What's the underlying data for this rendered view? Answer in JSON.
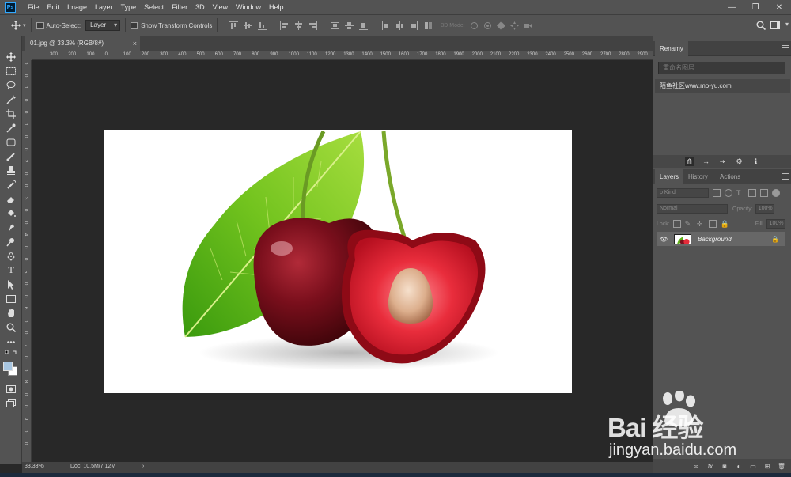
{
  "menubar": {
    "logo": "Ps",
    "items": [
      "File",
      "Edit",
      "Image",
      "Layer",
      "Type",
      "Select",
      "Filter",
      "3D",
      "View",
      "Window",
      "Help"
    ]
  },
  "options": {
    "auto_select_label": "Auto-Select:",
    "auto_select_value": "Layer",
    "transform_label": "Show Transform Controls",
    "mode3d_label": "3D Mode:"
  },
  "document": {
    "tab_title": "01.jpg @ 33.3% (RGB/8#)",
    "close_glyph": "×"
  },
  "ruler": {
    "top_labels": [
      "300",
      "200",
      "100",
      "0",
      "100",
      "200",
      "300",
      "400",
      "500",
      "600",
      "700",
      "800",
      "900",
      "1000",
      "1100",
      "1200",
      "1300",
      "1400",
      "1500",
      "1600",
      "1700",
      "1800",
      "1900",
      "2000",
      "2100",
      "2200",
      "2300",
      "2400",
      "2500",
      "2600",
      "2700",
      "2800",
      "2900"
    ],
    "left_labels": [
      "0",
      "0",
      "1",
      "0",
      "0",
      "1",
      "0",
      "0",
      "2",
      "0",
      "0",
      "3",
      "0",
      "0",
      "4",
      "0",
      "0",
      "5",
      "0",
      "0",
      "6",
      "0",
      "0",
      "7",
      "0",
      "0",
      "8",
      "0",
      "0",
      "9",
      "0",
      "0"
    ]
  },
  "status": {
    "zoom": "33.33%",
    "doc_info": "Doc: 10.5M/7.12M",
    "arrow": "›"
  },
  "rename_panel": {
    "tab_label": "Renamy",
    "search_placeholder": "重命名图层",
    "item": "陌鱼社区www.mo-yu.com"
  },
  "layers_panel": {
    "tabs": [
      "Layers",
      "History",
      "Actions"
    ],
    "kind_label": "ρ Kind",
    "blend_mode": "Normal",
    "opacity_label": "Opacity:",
    "opacity_value": "100%",
    "lock_label": "Lock:",
    "fill_label": "Fill:",
    "fill_value": "100%",
    "layer_name": "Background"
  },
  "watermark": {
    "brand": "Bai 经验",
    "url": "jingyan.baidu.com"
  },
  "colors": {
    "ui_dark": "#535353",
    "ui_darker": "#424242",
    "workspace": "#282828",
    "accent": "#31a8ff"
  }
}
